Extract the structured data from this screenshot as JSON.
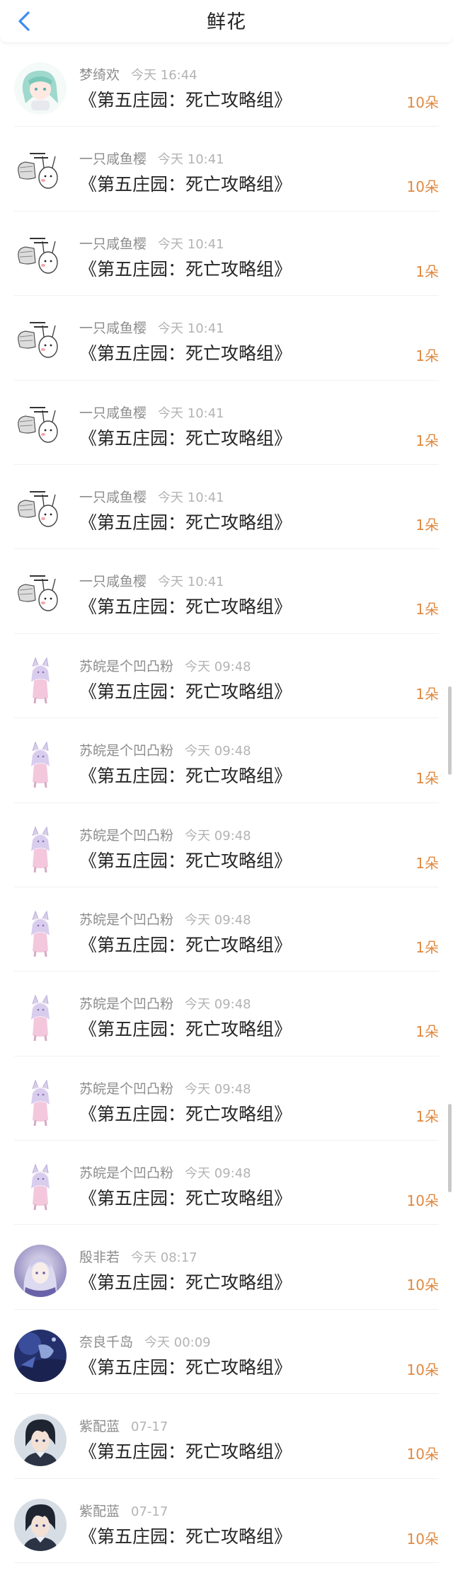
{
  "header": {
    "title": "鲜花",
    "back_icon": "chevron-left-icon",
    "accent": "#3d8cf0"
  },
  "count_color": "#e0883f",
  "records": [
    {
      "user": "梦绮欢",
      "time": "今天 16:44",
      "work": "《第五庄园：死亡攻略组》",
      "count": "10朵",
      "avatar": "anime-girl-green-hair"
    },
    {
      "user": "一只咸鱼樱",
      "time": "今天 10:41",
      "work": "《第五庄园：死亡攻略组》",
      "count": "10朵",
      "avatar": "meme-bunny"
    },
    {
      "user": "一只咸鱼樱",
      "time": "今天 10:41",
      "work": "《第五庄园：死亡攻略组》",
      "count": "1朵",
      "avatar": "meme-bunny"
    },
    {
      "user": "一只咸鱼樱",
      "time": "今天 10:41",
      "work": "《第五庄园：死亡攻略组》",
      "count": "1朵",
      "avatar": "meme-bunny"
    },
    {
      "user": "一只咸鱼樱",
      "time": "今天 10:41",
      "work": "《第五庄园：死亡攻略组》",
      "count": "1朵",
      "avatar": "meme-bunny"
    },
    {
      "user": "一只咸鱼樱",
      "time": "今天 10:41",
      "work": "《第五庄园：死亡攻略组》",
      "count": "1朵",
      "avatar": "meme-bunny"
    },
    {
      "user": "一只咸鱼樱",
      "time": "今天 10:41",
      "work": "《第五庄园：死亡攻略组》",
      "count": "1朵",
      "avatar": "meme-bunny"
    },
    {
      "user": "苏皖是个凹凸粉",
      "time": "今天 09:48",
      "work": "《第五庄园：死亡攻略组》",
      "count": "1朵",
      "avatar": "chibi-fox-girl"
    },
    {
      "user": "苏皖是个凹凸粉",
      "time": "今天 09:48",
      "work": "《第五庄园：死亡攻略组》",
      "count": "1朵",
      "avatar": "chibi-fox-girl"
    },
    {
      "user": "苏皖是个凹凸粉",
      "time": "今天 09:48",
      "work": "《第五庄园：死亡攻略组》",
      "count": "1朵",
      "avatar": "chibi-fox-girl"
    },
    {
      "user": "苏皖是个凹凸粉",
      "time": "今天 09:48",
      "work": "《第五庄园：死亡攻略组》",
      "count": "1朵",
      "avatar": "chibi-fox-girl"
    },
    {
      "user": "苏皖是个凹凸粉",
      "time": "今天 09:48",
      "work": "《第五庄园：死亡攻略组》",
      "count": "1朵",
      "avatar": "chibi-fox-girl"
    },
    {
      "user": "苏皖是个凹凸粉",
      "time": "今天 09:48",
      "work": "《第五庄园：死亡攻略组》",
      "count": "1朵",
      "avatar": "chibi-fox-girl"
    },
    {
      "user": "苏皖是个凹凸粉",
      "time": "今天 09:48",
      "work": "《第五庄园：死亡攻略组》",
      "count": "10朵",
      "avatar": "chibi-fox-girl"
    },
    {
      "user": "殷非若",
      "time": "今天 08:17",
      "work": "《第五庄园：死亡攻略组》",
      "count": "10朵",
      "avatar": "anime-silver-hair"
    },
    {
      "user": "奈良千岛",
      "time": "今天 00:09",
      "work": "《第五庄园：死亡攻略组》",
      "count": "10朵",
      "avatar": "dark-blue-portrait"
    },
    {
      "user": "紫配蓝",
      "time": "07-17",
      "work": "《第五庄园：死亡攻略组》",
      "count": "10朵",
      "avatar": "anime-boy-dark-hair"
    },
    {
      "user": "紫配蓝",
      "time": "07-17",
      "work": "《第五庄园：死亡攻略组》",
      "count": "10朵",
      "avatar": "anime-boy-dark-hair"
    }
  ]
}
